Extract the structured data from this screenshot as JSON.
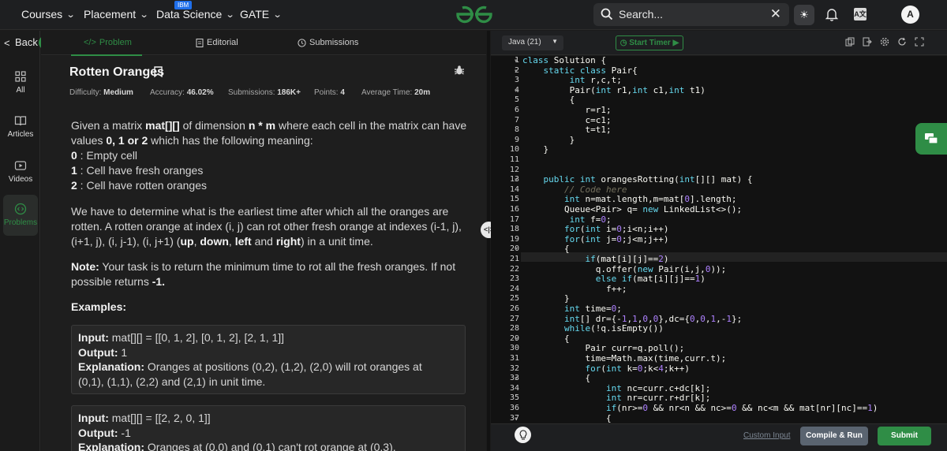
{
  "nav": {
    "items": [
      {
        "label": "Courses"
      },
      {
        "label": "Placement"
      },
      {
        "label": "Data Science"
      },
      {
        "label": "GATE"
      }
    ],
    "ibm_badge": "IBM",
    "search_placeholder": "Search...",
    "avatar_letter": "A",
    "logo_icon": "gfg-logo-icon",
    "brand_color": "#2f8d46"
  },
  "sidebar": {
    "back_label": "Back",
    "items": [
      {
        "label": "All",
        "icon": "grid-icon"
      },
      {
        "label": "Articles",
        "icon": "book-icon"
      },
      {
        "label": "Videos",
        "icon": "play-icon"
      },
      {
        "label": "Problems",
        "icon": "code-icon",
        "active": true
      }
    ]
  },
  "tabs": [
    {
      "label": "Problem",
      "active": true
    },
    {
      "label": "Editorial"
    },
    {
      "label": "Submissions"
    }
  ],
  "problem": {
    "title": "Rotten Oranges",
    "meta": [
      {
        "label": "Difficulty:",
        "value": "Medium"
      },
      {
        "label": "Accuracy:",
        "value": "46.02%"
      },
      {
        "label": "Submissions:",
        "value": "186K+"
      },
      {
        "label": "Points:",
        "value": "4"
      },
      {
        "label": "Average Time:",
        "value": "20m"
      }
    ],
    "desc_p1_a": "Given a matrix ",
    "desc_p1_b": "mat[][]",
    "desc_p1_c": " of dimension ",
    "desc_p1_d": "n * m",
    "desc_p1_e": " where each cell in the matrix can have",
    "desc_p1_f": "values ",
    "desc_p1_g": "0, 1 or 2",
    "desc_p1_h": " which has the following meaning:",
    "meanings": [
      {
        "k": "0",
        "v": " : Empty cell"
      },
      {
        "k": "1",
        "v": " : Cell have fresh oranges"
      },
      {
        "k": "2",
        "v": " : Cell have rotten oranges"
      }
    ],
    "p2_l1": "We have to determine what is the earliest time after which all the oranges are",
    "p2_l2": "rotten. A rotten orange at index (i, j) can rot other fresh orange at indexes (i-1, j),",
    "p2_l3a": "(i+1, j), (i, j-1), (i, j+1) (",
    "p2_up": "up",
    "p2_c1": ", ",
    "p2_down": "down",
    "p2_c2": ", ",
    "p2_left": "left",
    "p2_and": " and ",
    "p2_right": "right",
    "p2_end": ") in a unit time.",
    "note_label": "Note:",
    "note_l1": " Your task is to return the minimum time to rot all the fresh oranges. If not",
    "note_l2a": "possible returns ",
    "note_l2b": "-1.",
    "examples_label": "Examples:",
    "ex1": {
      "input_label": "Input:",
      "input": " mat[][]  =  [[0,  1,  2],  [0,  1,  2],  [2,  1,  1]]",
      "output_label": "Output:",
      "output": " 1",
      "expl_label": "Explanation:",
      "expl_l1": " Oranges  at  positions  (0,2),  (1,2),  (2,0)  will  rot  oranges  at",
      "expl_l2": "(0,1),  (1,1),  (2,2)  and  (2,1)  in  unit  time."
    },
    "ex2": {
      "input_label": "Input:",
      "input": " mat[][]  =  [[2,  2,  0,  1]]",
      "output_label": "Output:",
      "output": " -1",
      "expl_label": "Explanation:",
      "expl_l1": " Oranges  at  (0,0)  and  (0,1)  can't  rot  orange  at  (0,3)."
    }
  },
  "editor": {
    "language": "Java (21)",
    "timer_label": "Start Timer",
    "custom_input": "Custom Input",
    "compile_run": "Compile & Run",
    "submit": "Submit",
    "line_numbers": [
      "1",
      "2",
      "3",
      "4",
      "5",
      "6",
      "7",
      "8",
      "9",
      "10",
      "11",
      "12",
      "13",
      "14",
      "15",
      "16",
      "17",
      "18",
      "19",
      "20",
      "21",
      "22",
      "23",
      "24",
      "25",
      "26",
      "27",
      "28",
      "29",
      "30",
      "31",
      "32",
      "33",
      "34",
      "35",
      "36",
      "37"
    ],
    "code": [
      "class Solution {",
      "    static class Pair{",
      "         int r,c,t;",
      "         Pair(int r1,int c1,int t1)",
      "         {",
      "            r=r1;",
      "            c=c1;",
      "            t=t1;",
      "         }",
      "    }",
      "",
      "",
      "    public int orangesRotting(int[][] mat) {",
      "        // Code here",
      "        int n=mat.length,m=mat[0].length;",
      "        Queue<Pair> q= new LinkedList<>();",
      "         int f=0;",
      "        for(int i=0;i<n;i++)",
      "        for(int j=0;j<m;j++)",
      "        {",
      "            if(mat[i][j]==2)",
      "              q.offer(new Pair(i,j,0));",
      "              else if(mat[i][j]==1)",
      "                f++;",
      "        }",
      "        int time=0;",
      "        int[] dr={-1,1,0,0},dc={0,0,1,-1};",
      "        while(!q.isEmpty())",
      "        {",
      "            Pair curr=q.poll();",
      "            time=Math.max(time,curr.t);",
      "            for(int k=0;k<4;k++)",
      "            {",
      "                int nc=curr.c+dc[k];",
      "                int nr=curr.r+dr[k];",
      "                if(nr>=0 && nr<n && nc>=0 && nc<m && mat[nr][nc]==1)",
      "                {"
    ],
    "fold_lines": [
      "1",
      "2",
      "4",
      "13",
      "20",
      "29",
      "33",
      "37"
    ]
  }
}
